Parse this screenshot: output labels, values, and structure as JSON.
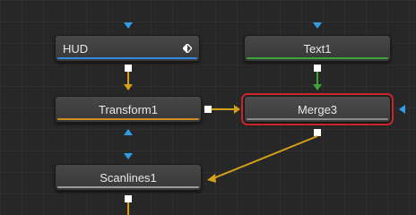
{
  "nodes": {
    "hud": {
      "label": "HUD",
      "bar_color": "#2f8ae0",
      "icon": "diamond-half-icon"
    },
    "text1": {
      "label": "Text1",
      "bar_color": "#3aa638"
    },
    "transform1": {
      "label": "Transform1",
      "bar_color": "#d08a1f"
    },
    "merge3": {
      "label": "Merge3",
      "bar_color": "#8a8a8a",
      "selected": true,
      "selection_color": "#c8262b"
    },
    "scanlines1": {
      "label": "Scanlines1",
      "bar_color": "#9a9a9a"
    }
  },
  "colors": {
    "background_input": "#d4a017",
    "mask_input": "#3c8ee0",
    "foreground_input": "#3aa638",
    "output_port": "#ffffff",
    "selection": "#c8262b"
  }
}
